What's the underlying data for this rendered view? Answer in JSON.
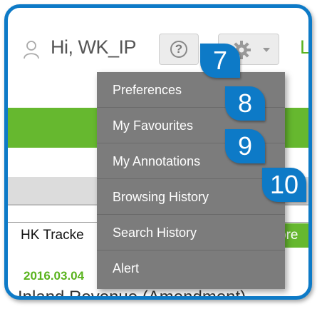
{
  "header": {
    "greeting": "Hi, WK_IP",
    "help_symbol": "?",
    "login_label": "Lo",
    "user_icon": "user-icon",
    "gear_icon": "gear-icon"
  },
  "tabs": {
    "hk_tracker": "HK Tracke",
    "more": "ore"
  },
  "content": {
    "date": "2016.03.04",
    "headline": "Inland Revenue (Amendment)"
  },
  "menu": {
    "items": [
      {
        "label": "Preferences"
      },
      {
        "label": "My Favourites"
      },
      {
        "label": "My Annotations"
      },
      {
        "label": "Browsing History"
      },
      {
        "label": "Search History"
      },
      {
        "label": "Alert"
      }
    ]
  },
  "callouts": [
    "7",
    "8",
    "9",
    "10"
  ],
  "colors": {
    "frame": "#0d7ac7",
    "accent_green": "#66b82f",
    "menu_bg": "#7c7c7c"
  }
}
